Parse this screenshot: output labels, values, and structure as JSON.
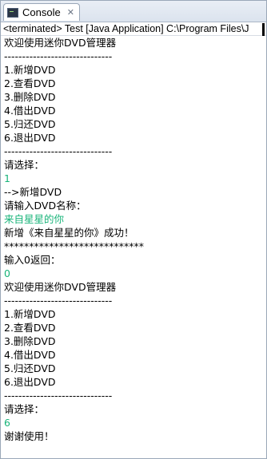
{
  "tab": {
    "label": "Console",
    "close_symbol": "✕",
    "icon": "console-icon"
  },
  "status": "<terminated> Test [Java Application] C:\\Program Files\\J",
  "colors": {
    "input": "#19b47a",
    "output": "#000000"
  },
  "console_lines": [
    {
      "text": "欢迎使用迷你DVD管理器",
      "kind": "out"
    },
    {
      "text": "------------------------------",
      "kind": "out"
    },
    {
      "text": "1.新增DVD",
      "kind": "out"
    },
    {
      "text": "2.查看DVD",
      "kind": "out"
    },
    {
      "text": "3.删除DVD",
      "kind": "out"
    },
    {
      "text": "4.借出DVD",
      "kind": "out"
    },
    {
      "text": "5.归还DVD",
      "kind": "out"
    },
    {
      "text": "6.退出DVD",
      "kind": "out"
    },
    {
      "text": "------------------------------",
      "kind": "out"
    },
    {
      "text": "请选择：",
      "kind": "out"
    },
    {
      "text": "1",
      "kind": "in"
    },
    {
      "text": "-->新增DVD",
      "kind": "out"
    },
    {
      "text": "请输入DVD名称：",
      "kind": "out"
    },
    {
      "text": "来自星星的你",
      "kind": "in"
    },
    {
      "text": "新增《来自星星的你》成功！",
      "kind": "out"
    },
    {
      "text": "****************************",
      "kind": "out"
    },
    {
      "text": "输入0返回：",
      "kind": "out"
    },
    {
      "text": "0",
      "kind": "in"
    },
    {
      "text": "欢迎使用迷你DVD管理器",
      "kind": "out"
    },
    {
      "text": "------------------------------",
      "kind": "out"
    },
    {
      "text": "1.新增DVD",
      "kind": "out"
    },
    {
      "text": "2.查看DVD",
      "kind": "out"
    },
    {
      "text": "3.删除DVD",
      "kind": "out"
    },
    {
      "text": "4.借出DVD",
      "kind": "out"
    },
    {
      "text": "5.归还DVD",
      "kind": "out"
    },
    {
      "text": "6.退出DVD",
      "kind": "out"
    },
    {
      "text": "------------------------------",
      "kind": "out"
    },
    {
      "text": "请选择：",
      "kind": "out"
    },
    {
      "text": "6",
      "kind": "in"
    },
    {
      "text": "谢谢使用！",
      "kind": "out"
    }
  ]
}
